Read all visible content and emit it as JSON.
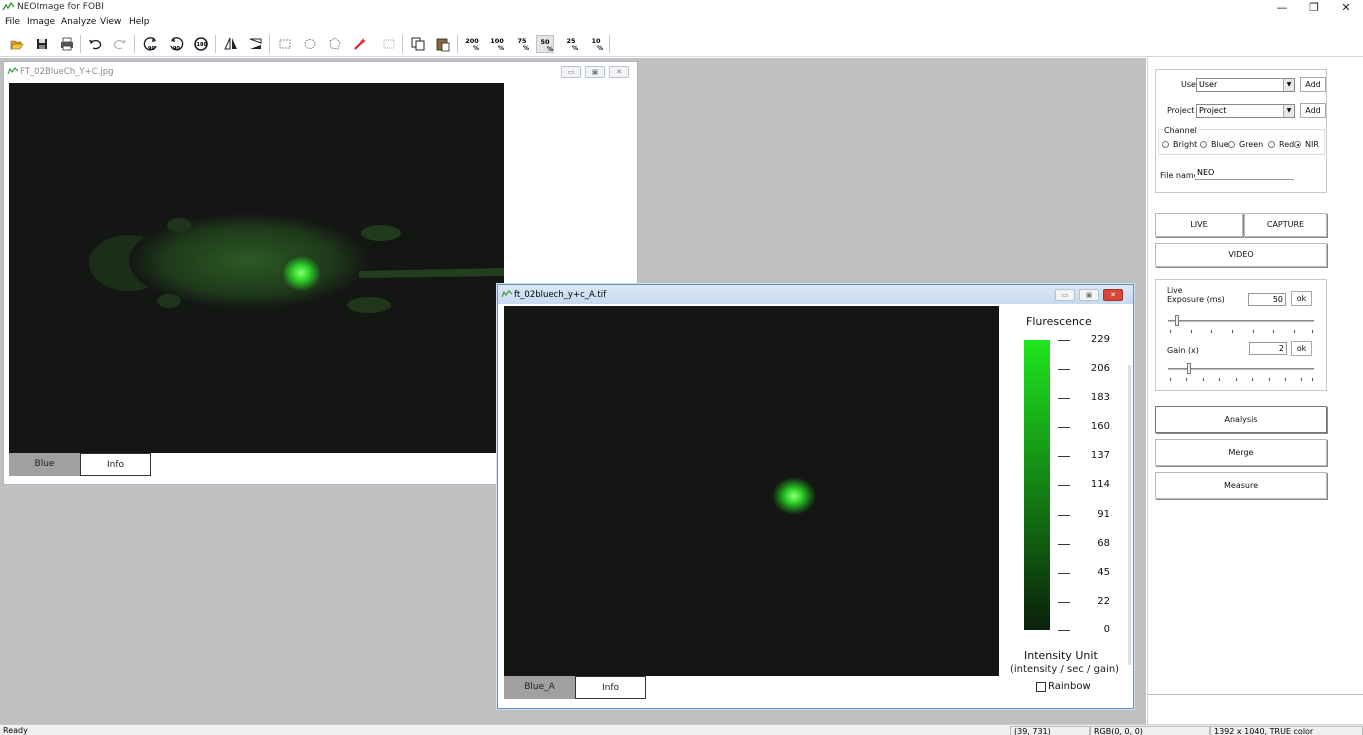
{
  "app": {
    "title": "NEOImage for FOBI"
  },
  "window_controls": {
    "minimize": "—",
    "restore": "❐",
    "close": "✕"
  },
  "menu": [
    "File",
    "Image",
    "Analyze",
    "View",
    "Help"
  ],
  "toolbar": {
    "icons": [
      "open-icon",
      "save-icon",
      "print-icon",
      "undo-icon",
      "redo-icon",
      "rotate-left-icon",
      "rotate-right-icon",
      "rotate-180-icon",
      "flip-horizontal-icon",
      "flip-vertical-icon",
      "rect-select-icon",
      "ellipse-select-icon",
      "polygon-select-icon",
      "magic-wand-icon",
      "crop-icon",
      "copy-icon",
      "paste-icon"
    ],
    "zoom_levels": [
      {
        "label": "200",
        "unit": "%"
      },
      {
        "label": "100",
        "unit": "%"
      },
      {
        "label": "75",
        "unit": "%"
      },
      {
        "label": "50",
        "unit": "%"
      },
      {
        "label": "25",
        "unit": "%"
      },
      {
        "label": "10",
        "unit": "%"
      }
    ]
  },
  "image_window_1": {
    "title": "FT_02BlueCh_Y+C.jpg",
    "tab_selected": "Blue",
    "tab_other": "Info"
  },
  "image_window_2": {
    "title": "ft_02bluech_y+c_A.tif",
    "tab_selected": "Blue_A",
    "tab_other": "Info",
    "legend": {
      "title": "Flurescence",
      "ticks": [
        "229",
        "206",
        "183",
        "160",
        "137",
        "114",
        "91",
        "68",
        "45",
        "22",
        "0"
      ],
      "unit_title": "Intensity Unit",
      "unit_sub": "(intensity / sec / gain)",
      "rainbow_label": "Rainbow",
      "rainbow_checked": false,
      "colors": {
        "top": "#1ee61e",
        "bottom": "#0b200b"
      }
    }
  },
  "panel": {
    "user_label": "User",
    "user_value": "User",
    "user_add": "Add",
    "project_label": "Project",
    "project_value": "Project",
    "project_add": "Add",
    "channel_label": "Channel",
    "channels": [
      {
        "label": "Bright",
        "selected": false
      },
      {
        "label": "Blue",
        "selected": false
      },
      {
        "label": "Green",
        "selected": false
      },
      {
        "label": "Red",
        "selected": false
      },
      {
        "label": "NIR",
        "selected": true
      }
    ],
    "filename_label": "File name",
    "filename_value": "NEO",
    "live_button": "LIVE",
    "capture_button": "CAPTURE",
    "video_button": "VIDEO",
    "live_label": "Live",
    "exposure_label": "Exposure (ms)",
    "exposure_value": "50",
    "exposure_ok": "ok",
    "gain_label": "Gain (x)",
    "gain_value": "2",
    "gain_ok": "ok",
    "analysis_button": "Analysis",
    "merge_button": "Merge",
    "measure_button": "Measure"
  },
  "status": {
    "ready": "Ready",
    "coords": "(39, 731)",
    "rgb": "RGB(0, 0, 0)",
    "size": "1392 x 1040, TRUE color"
  }
}
